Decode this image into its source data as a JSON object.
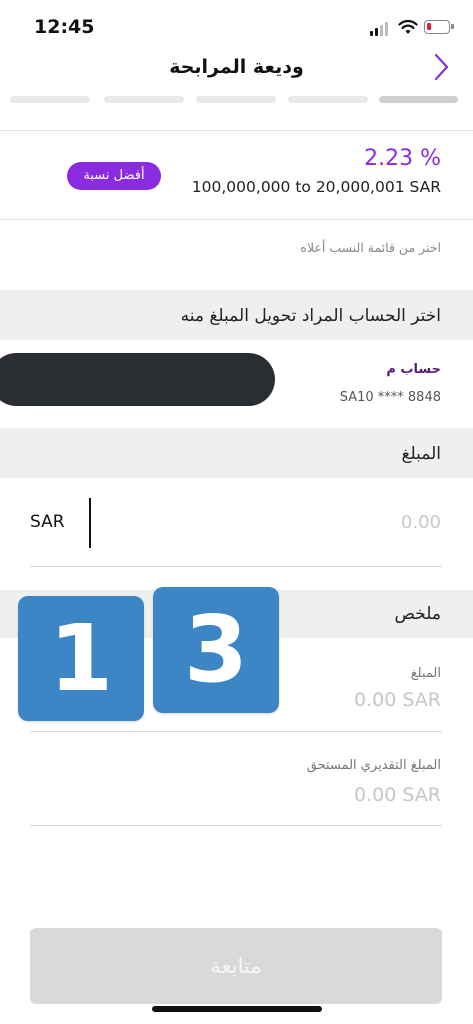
{
  "status_bar": {
    "time": "12:45"
  },
  "header": {
    "title": "وديعة المرابحة",
    "back_icon": "chevron-right-icon",
    "accent": "#8a2be2"
  },
  "progress": {
    "total_steps": 5,
    "current_step": 1
  },
  "rate_card": {
    "rate": "2.23 %",
    "badge": "أفضل نسبة",
    "range": "100,000,000 to 20,000,001 SAR"
  },
  "hint": "اختر من قائمة النسب أعلاه",
  "account_section": {
    "title": "اختر الحساب المراد تحويل المبلغ منه",
    "account_name": "حساب م",
    "account_number": "SA10 **** 8848"
  },
  "amount_section": {
    "title": "المبلغ",
    "currency": "SAR",
    "placeholder": "0.00"
  },
  "overlay_badges": {
    "left": "1",
    "right": "3",
    "color": "#3c86c6"
  },
  "summary": {
    "title": "ملخص",
    "amount_label": "المبلغ",
    "amount_value": "0.00 SAR",
    "estimated_label": "المبلغ التقديري المستحق",
    "estimated_value": "0.00 SAR"
  },
  "footer": {
    "continue_label": "متابعة"
  }
}
